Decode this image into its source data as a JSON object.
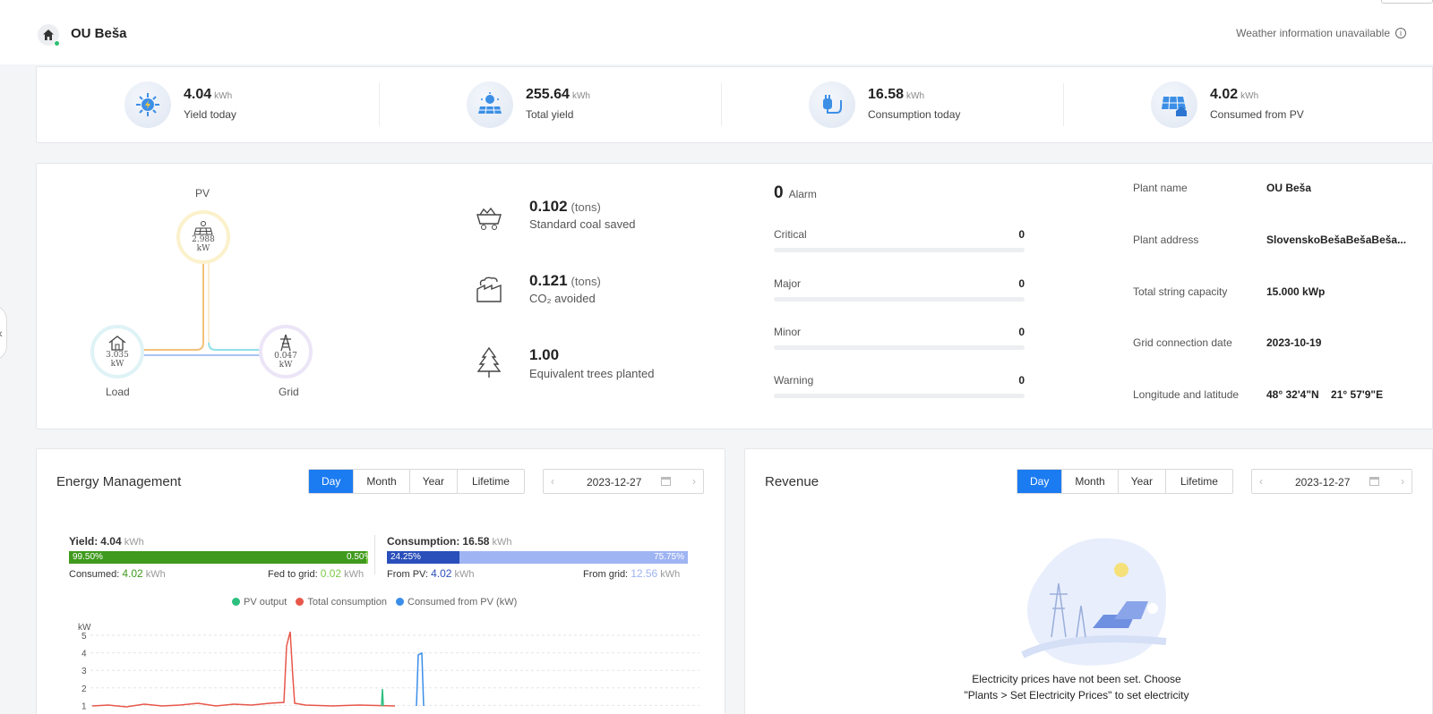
{
  "header": {
    "plant_name": "OU Beša",
    "weather": "Weather information unavailable"
  },
  "kpis": [
    {
      "value": "4.04",
      "unit": "kWh",
      "label": "Yield today",
      "icon": "sun-yield-icon"
    },
    {
      "value": "255.64",
      "unit": "kWh",
      "label": "Total yield",
      "icon": "solar-panel-sun-icon"
    },
    {
      "value": "16.58",
      "unit": "kWh",
      "label": "Consumption today",
      "icon": "plug-icon"
    },
    {
      "value": "4.02",
      "unit": "kWh",
      "label": "Consumed from PV",
      "icon": "panel-home-icon"
    }
  ],
  "flow": {
    "pv": {
      "label": "PV",
      "value": "2.988",
      "unit": "kW"
    },
    "load": {
      "label": "Load",
      "value": "3.035",
      "unit": "kW"
    },
    "grid": {
      "label": "Grid",
      "value": "0.047",
      "unit": "kW"
    }
  },
  "environment": [
    {
      "value": "0.102",
      "unit": "(tons)",
      "label": "Standard coal saved",
      "icon": "coal-cart-icon"
    },
    {
      "value": "0.121",
      "unit": "(tons)",
      "label": "CO₂ avoided",
      "icon": "factory-icon"
    },
    {
      "value": "1.00",
      "unit": "",
      "label": "Equivalent trees planted",
      "icon": "tree-icon"
    }
  ],
  "alarms": {
    "total": "0",
    "total_label": "Alarm",
    "rows": [
      {
        "name": "Critical",
        "count": "0"
      },
      {
        "name": "Major",
        "count": "0"
      },
      {
        "name": "Minor",
        "count": "0"
      },
      {
        "name": "Warning",
        "count": "0"
      }
    ]
  },
  "plant_info": [
    {
      "key": "Plant name",
      "value": "OU Beša"
    },
    {
      "key": "Plant address",
      "value": "SlovenskoBešaBešaBeša..."
    },
    {
      "key": "Total string capacity",
      "value": "15.000 kWp"
    },
    {
      "key": "Grid connection date",
      "value": "2023-10-19"
    },
    {
      "key": "Longitude and latitude",
      "value": "48° 32'4\"N    21° 57'9\"E"
    }
  ],
  "energy": {
    "title": "Energy Management",
    "tabs": [
      "Day",
      "Month",
      "Year",
      "Lifetime"
    ],
    "active_tab": "Day",
    "date": "2023-12-27",
    "yield": {
      "label": "Yield:",
      "value": "4.04",
      "unit": "kWh",
      "consumed_pct": "99.50%",
      "fed_pct": "0.50%",
      "consumed_fraction": 0.995,
      "consumed_label": "Consumed:",
      "consumed_value": "4.02",
      "fed_label": "Fed to grid:",
      "fed_value": "0.02",
      "unit2": "kWh"
    },
    "consumption": {
      "label": "Consumption:",
      "value": "16.58",
      "unit": "kWh",
      "pv_pct": "24.25%",
      "grid_pct": "75.75%",
      "pv_fraction": 0.2425,
      "from_pv_label": "From PV:",
      "from_pv_value": "4.02",
      "from_grid_label": "From grid:",
      "from_grid_value": "12.56",
      "unit2": "kWh"
    },
    "legend": [
      {
        "name": "PV output",
        "color": "#2dbf7f"
      },
      {
        "name": "Total consumption",
        "color": "#e8574b"
      },
      {
        "name": "Consumed from PV (kW)",
        "color": "#3b8ee8"
      }
    ]
  },
  "chart_data": {
    "type": "line",
    "ylabel": "kW",
    "ylim": [
      0,
      5
    ],
    "yticks": [
      "5",
      "4",
      "3",
      "2",
      "1"
    ]
  },
  "revenue": {
    "title": "Revenue",
    "tabs": [
      "Day",
      "Month",
      "Year",
      "Lifetime"
    ],
    "active_tab": "Day",
    "date": "2023-12-27",
    "empty_line1": "Electricity prices have not been set. Choose",
    "empty_line2": "\"Plants > Set Electricity Prices\" to set electricity"
  }
}
